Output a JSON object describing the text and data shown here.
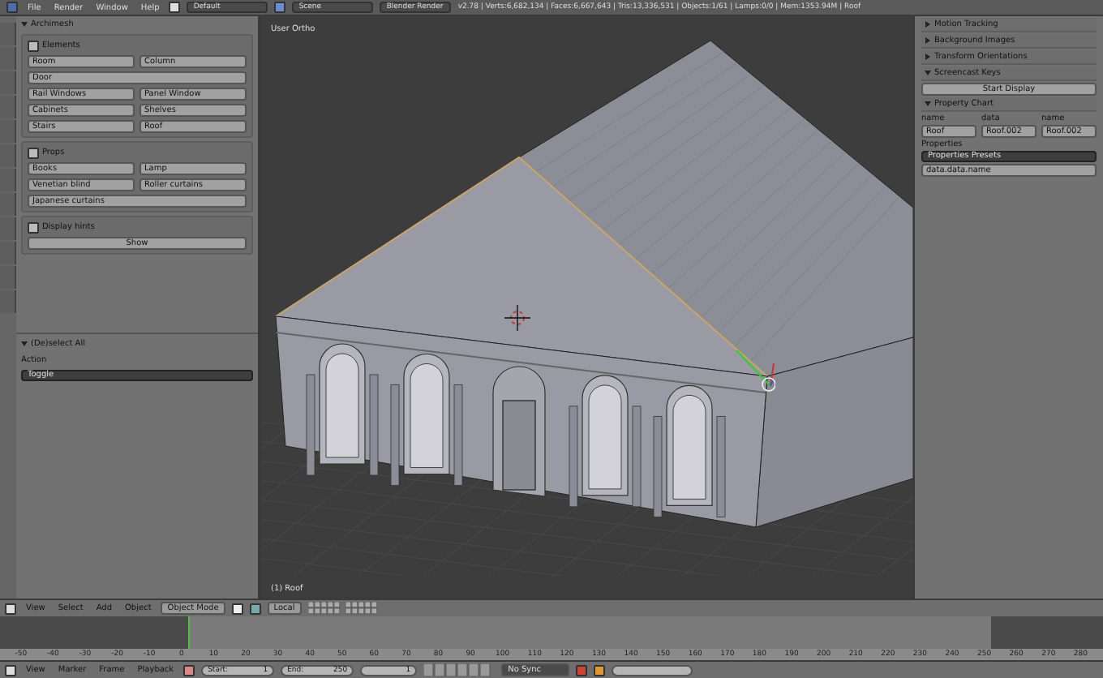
{
  "menubar": {
    "menus": [
      "File",
      "Render",
      "Window",
      "Help"
    ],
    "layout": "Default",
    "scene": "Scene",
    "engine": "Blender Render",
    "stats": "v2.78 | Verts:6,682,134 | Faces:6,667,643 | Tris:13,336,531 | Objects:1/61 | Lamps:0/0 | Mem:1353.94M | Roof"
  },
  "toolshelf": {
    "title": "Archimesh",
    "expanded": true,
    "panels": [
      {
        "title": "Elements",
        "rows": [
          [
            "Room",
            "Column"
          ],
          [
            "Door"
          ],
          [
            "Rail Windows",
            "Panel Window"
          ],
          [
            "Cabinets",
            "Shelves"
          ],
          [
            "Stairs",
            "Roof"
          ]
        ]
      },
      {
        "title": "Props",
        "rows": [
          [
            "Books",
            "Lamp"
          ],
          [
            "Venetian blind",
            "Roller curtains"
          ],
          [
            "Japanese curtains"
          ]
        ]
      },
      {
        "title": "Display hints",
        "rows": [
          [
            "Show"
          ]
        ]
      }
    ]
  },
  "operator": {
    "title": "(De)select All",
    "expanded": true,
    "label": "Action",
    "value": "Toggle"
  },
  "viewport": {
    "view_name": "User Ortho",
    "object_label": "(1) Roof"
  },
  "properties": {
    "panels": [
      {
        "title": "Motion Tracking",
        "expanded": false
      },
      {
        "title": "Background Images",
        "expanded": false
      },
      {
        "title": "Transform Orientations",
        "expanded": false
      },
      {
        "title": "Screencast Keys",
        "expanded": true,
        "button": "Start Display"
      },
      {
        "title": "Property Chart",
        "expanded": true
      }
    ],
    "chart": {
      "columns": [
        "name",
        "data",
        "name"
      ],
      "cells": [
        "Roof",
        "Roof.002",
        "Roof.002"
      ],
      "label": "Properties",
      "preset": "Properties Presets",
      "path": "data.data.name"
    }
  },
  "view_header": {
    "menus": [
      "View",
      "Select",
      "Add",
      "Object"
    ],
    "mode": "Object Mode",
    "orientation": "Local"
  },
  "timeline": {
    "ticks": [
      "-50",
      "-40",
      "-30",
      "-20",
      "-10",
      "0",
      "10",
      "20",
      "30",
      "40",
      "50",
      "60",
      "70",
      "80",
      "90",
      "100",
      "110",
      "120",
      "130",
      "140",
      "150",
      "160",
      "170",
      "180",
      "190",
      "200",
      "210",
      "220",
      "230",
      "240",
      "250",
      "260",
      "270",
      "280"
    ],
    "menus": [
      "View",
      "Marker",
      "Frame",
      "Playback"
    ],
    "start_label": "Start:",
    "start_value": "1",
    "end_label": "End:",
    "end_value": "250",
    "frame_value": "1",
    "sync": "No Sync"
  }
}
